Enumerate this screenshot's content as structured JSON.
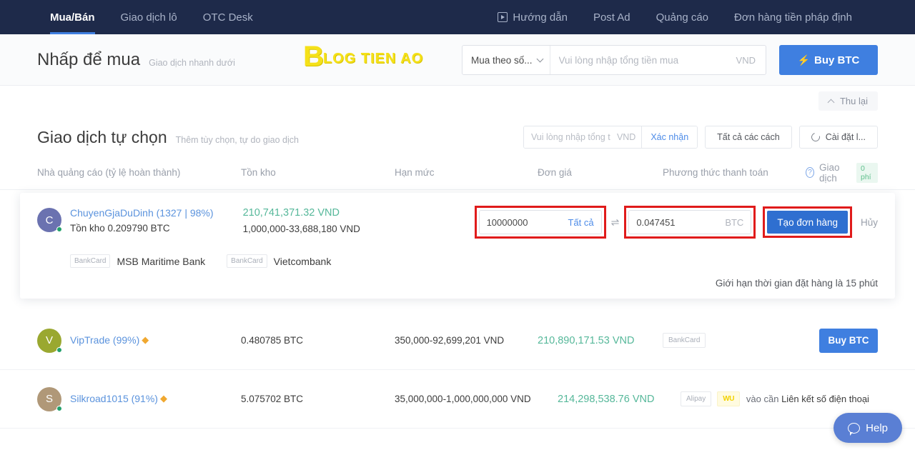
{
  "topnav": {
    "left_items": [
      {
        "label": "Mua/Bán",
        "active": true
      },
      {
        "label": "Giao dịch lô",
        "active": false
      },
      {
        "label": "OTC Desk",
        "active": false
      }
    ],
    "right_items": [
      {
        "label": "Hướng dẫn",
        "icon": "video-icon"
      },
      {
        "label": "Post Ad",
        "icon": ""
      },
      {
        "label": "Quảng cáo",
        "icon": ""
      },
      {
        "label": "Đơn hàng tiền pháp định",
        "icon": ""
      }
    ]
  },
  "quickbuy": {
    "title": "Nhấp để mua",
    "subtitle": "Giao dịch nhanh dưới",
    "logo_initial": "B",
    "logo_text": "LOG TIEN AO",
    "select_label": "Mua theo số...",
    "amount_placeholder": "Vui lòng nhập tổng tiền mua",
    "amount_value": "",
    "currency": "VND",
    "buy_button": "Buy BTC"
  },
  "collapse": {
    "label": "Thu lại"
  },
  "section": {
    "title": "Giao dịch tự chọn",
    "subtitle": "Thêm tùy chọn, tự do giao dịch",
    "filter_placeholder": "Vui lòng nhập tổng t",
    "filter_value": "",
    "filter_unit": "VND",
    "confirm_label": "Xác nhận",
    "all_methods_label": "Tất cả các cách",
    "settings_label": "Cài đặt l..."
  },
  "table": {
    "headers": {
      "advertiser": "Nhà quảng cáo (tỷ lệ hoàn thành)",
      "stock": "Tồn kho",
      "limit": "Hạn mức",
      "price": "Đơn giá",
      "payment": "Phương thức thanh toán",
      "trade": "Giao dịch",
      "fee_badge": "0 phí"
    },
    "expanded_row": {
      "avatar_letter": "C",
      "avatar_color": "#6b72b0",
      "name": "ChuyenGjaDuDinh (1327 | 98%)",
      "stock": "Tồn kho 0.209790 BTC",
      "price": "210,741,371.32 VND",
      "limit": "1,000,000-33,688,180 VND",
      "fiat_value": "10000000",
      "fiat_all_label": "Tất cả",
      "swap_icon": "⇌",
      "crypto_value": "0.047451",
      "crypto_unit": "BTC",
      "create_order_label": "Tạo đơn hàng",
      "cancel_label": "Hủy",
      "payments": [
        {
          "tag": "BankCard",
          "name": "MSB Maritime Bank"
        },
        {
          "tag": "BankCard",
          "name": "Vietcombank"
        }
      ],
      "time_limit_note": "Giới hạn thời gian đặt hàng là 15 phút"
    },
    "rows": [
      {
        "avatar_letter": "V",
        "avatar_color": "#9aa830",
        "name": "VipTrade (99%)",
        "vip_icon": "vip-badge-icon",
        "stock": "0.480785 BTC",
        "limit": "350,000-92,699,201 VND",
        "price": "210,890,171.53 VND",
        "payment_tags": [
          "BankCard"
        ],
        "wu_tag": "",
        "note": "",
        "note_link": "",
        "action_label": "Buy BTC"
      },
      {
        "avatar_letter": "S",
        "avatar_color": "#b09878",
        "name": "Silkroad1015 (91%)",
        "vip_icon": "vip-badge-icon",
        "stock": "5.075702 BTC",
        "limit": "35,000,000-1,000,000,000 VND",
        "price": "214,298,538.76 VND",
        "payment_tags": [
          "Alipay"
        ],
        "wu_tag": "WU",
        "note": "vào cần ",
        "note_link": "Liên kết số điện thoại",
        "action_label": ""
      }
    ]
  },
  "help": {
    "label": "Help"
  },
  "colors": {
    "nav_bg": "#1e2a4a",
    "accent": "#3f7fe0",
    "price_green": "#56b89a",
    "link_blue": "#5b93dd",
    "highlight_red": "#e01b1b"
  }
}
